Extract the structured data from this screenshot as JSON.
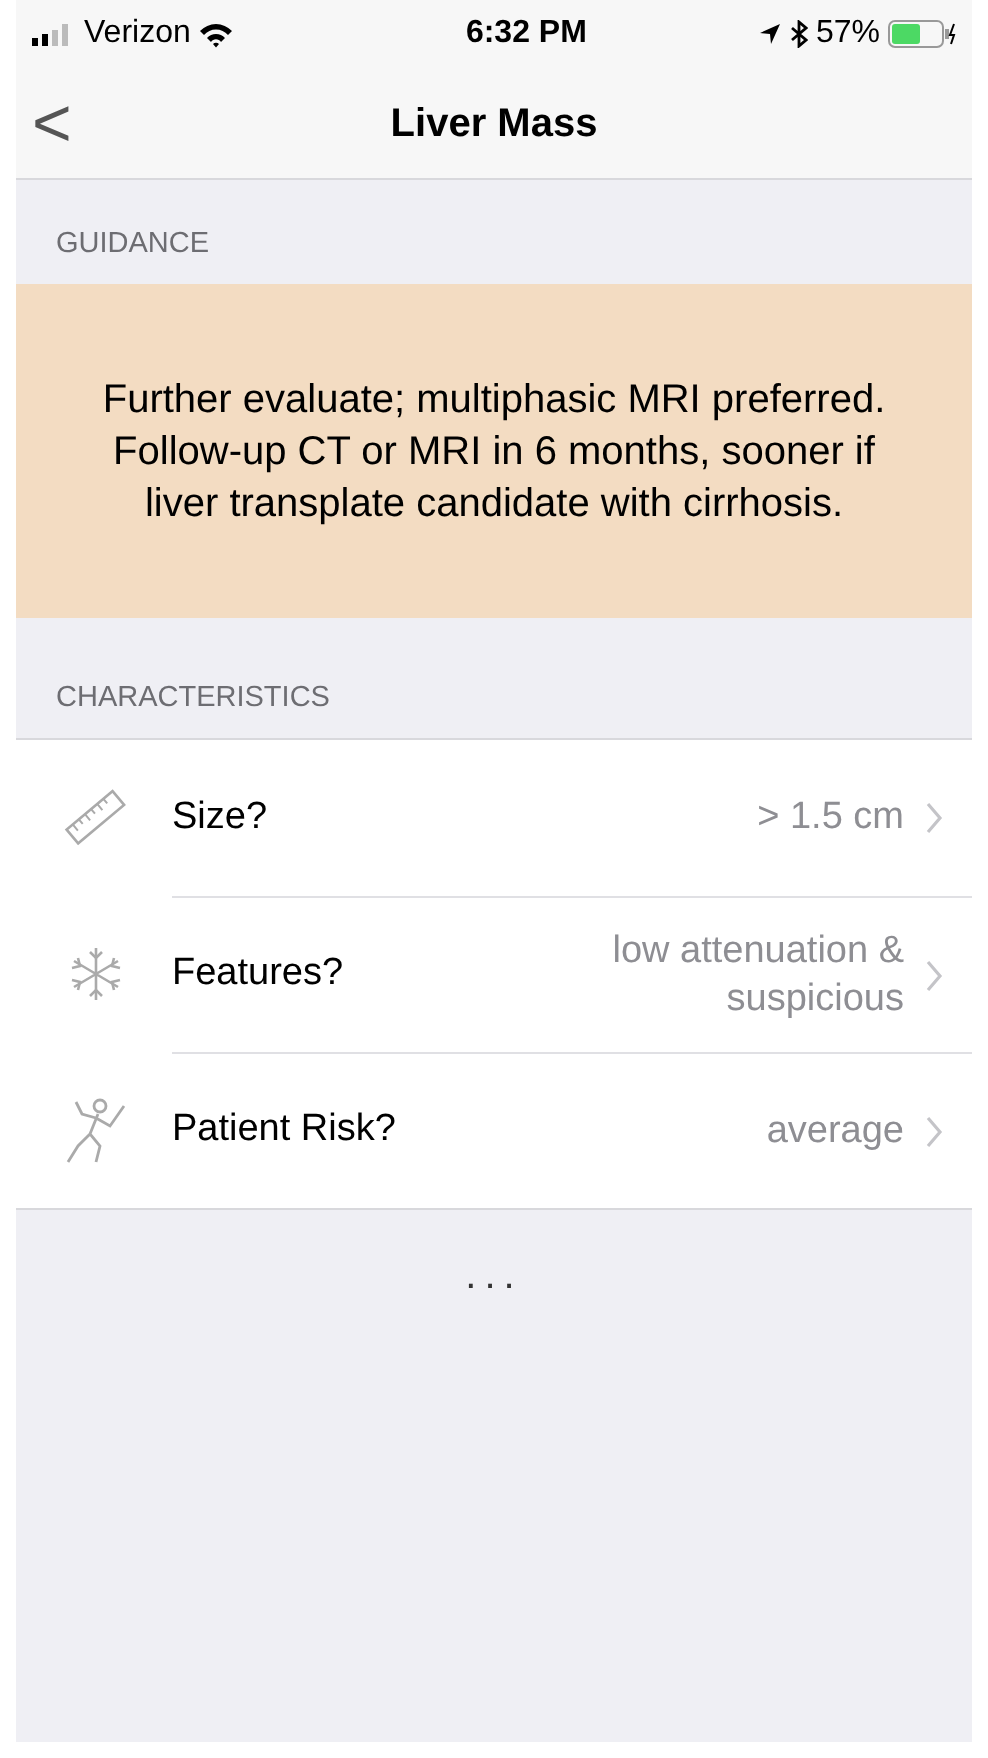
{
  "status_bar": {
    "carrier": "Verizon",
    "time": "6:32 PM",
    "battery": "57%"
  },
  "nav": {
    "back": "<",
    "title": "Liver Mass"
  },
  "guidance": {
    "header": "GUIDANCE",
    "text": "Further evaluate; multiphasic MRI preferred. Follow-up CT or MRI in 6 months, sooner if liver transplate candidate with cirrhosis."
  },
  "characteristics": {
    "header": "CHARACTERISTICS",
    "rows": [
      {
        "label": "Size?",
        "value": "> 1.5 cm"
      },
      {
        "label": "Features?",
        "value": "low attenuation & suspicious"
      },
      {
        "label": "Patient Risk?",
        "value": "average"
      }
    ]
  },
  "more": "..."
}
